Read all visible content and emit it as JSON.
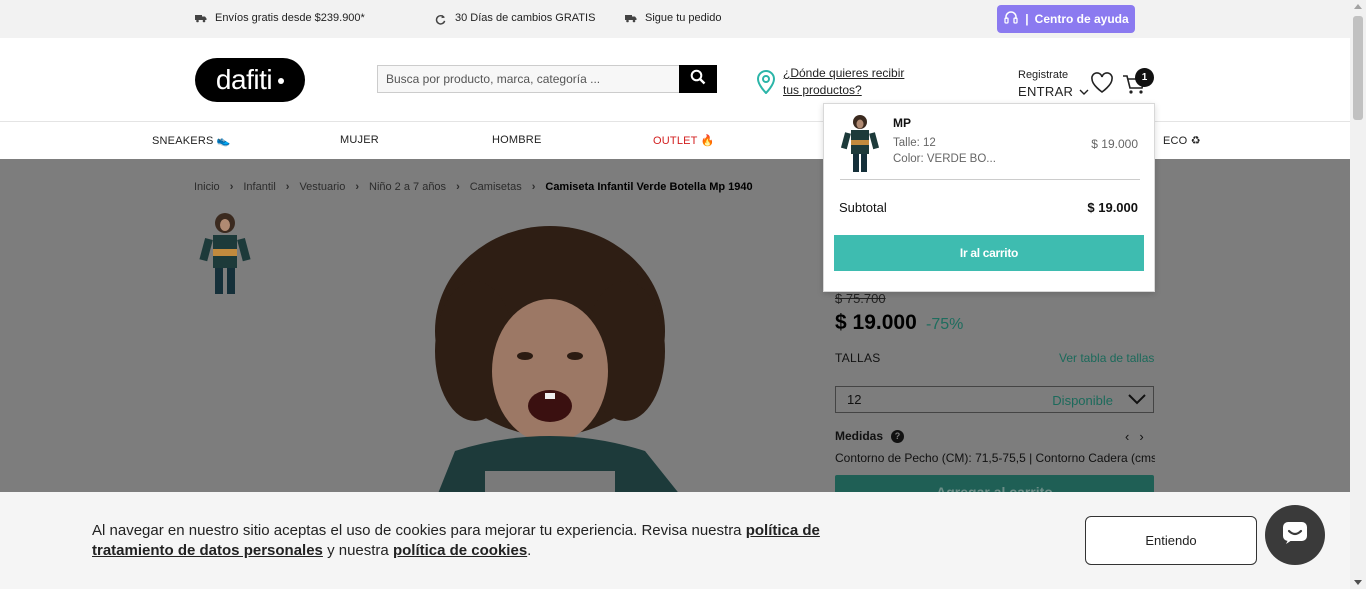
{
  "topbar": {
    "perks": [
      {
        "label": "Envíos gratis desde $239.900*",
        "icon": "truck-icon"
      },
      {
        "label": "30 Días de cambios GRATIS",
        "icon": "refresh-icon"
      },
      {
        "label": "Sigue tu pedido",
        "icon": "truck-icon"
      }
    ],
    "help_label": "Centro de ayuda",
    "help_icon": "headset-icon"
  },
  "header": {
    "logo_text": "dafiti",
    "search_placeholder": "Busca por producto, marca, categoría ...",
    "location_text": "¿Dónde quieres recibir tus productos?",
    "account_top": "Registrate",
    "account_bottom": "ENTRAR",
    "cart_count": "1"
  },
  "nav": {
    "items": [
      "SNEAKERS 👟",
      "MUJER",
      "HOMBRE",
      "OUTLET 🔥",
      "ECO ♻"
    ]
  },
  "breadcrumb": [
    "Inicio",
    "Infantil",
    "Vestuario",
    "Niño 2 a 7 años",
    "Camisetas",
    "Camiseta Infantil Verde Botella Mp 1940"
  ],
  "product": {
    "old_price": "$ 75.700",
    "price": "$ 19.000",
    "discount": "-75%",
    "sizes_label": "TALLAS",
    "size_table_link": "Ver tabla de tallas",
    "selected_size": "12",
    "availability": "Disponible",
    "measures_label": "Medidas",
    "measures_text": "Contorno de Pecho (CM): 71,5-75,5 | Contorno Cadera (cms",
    "add_to_cart": "Agregar al carrito"
  },
  "minicart": {
    "brand": "MP",
    "size": "Talle: 12",
    "color": "Color: VERDE BO...",
    "price": "$ 19.000",
    "subtotal_label": "Subtotal",
    "subtotal_value": "$ 19.000",
    "go_to_cart": "Ir al carrito"
  },
  "cookie": {
    "text_before": "Al navegar en nuestro sitio aceptas el uso de cookies para mejorar tu experiencia. Revisa nuestra ",
    "link1": "política de tratamiento de datos personales",
    "text_middle": " y nuestra ",
    "link2": "política de cookies",
    "text_after": ".",
    "accept": "Entiendo"
  },
  "colors": {
    "accent_teal": "#3ebcb0",
    "help_purple": "#8b7af0",
    "outlet_red": "#d32020"
  }
}
